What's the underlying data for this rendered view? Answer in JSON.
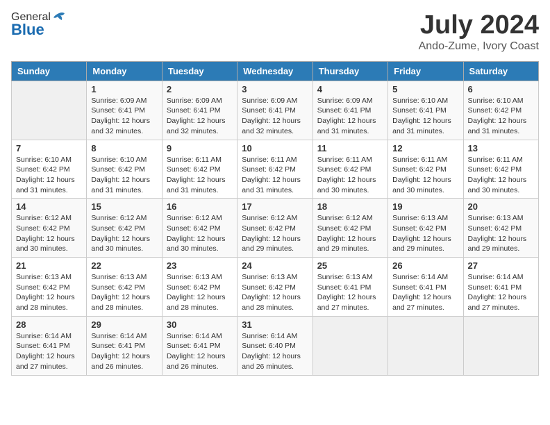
{
  "header": {
    "logo_general": "General",
    "logo_blue": "Blue",
    "month_title": "July 2024",
    "location": "Ando-Zume, Ivory Coast"
  },
  "days_of_week": [
    "Sunday",
    "Monday",
    "Tuesday",
    "Wednesday",
    "Thursday",
    "Friday",
    "Saturday"
  ],
  "weeks": [
    [
      {
        "day": "",
        "info": ""
      },
      {
        "day": "1",
        "info": "Sunrise: 6:09 AM\nSunset: 6:41 PM\nDaylight: 12 hours\nand 32 minutes."
      },
      {
        "day": "2",
        "info": "Sunrise: 6:09 AM\nSunset: 6:41 PM\nDaylight: 12 hours\nand 32 minutes."
      },
      {
        "day": "3",
        "info": "Sunrise: 6:09 AM\nSunset: 6:41 PM\nDaylight: 12 hours\nand 32 minutes."
      },
      {
        "day": "4",
        "info": "Sunrise: 6:09 AM\nSunset: 6:41 PM\nDaylight: 12 hours\nand 31 minutes."
      },
      {
        "day": "5",
        "info": "Sunrise: 6:10 AM\nSunset: 6:41 PM\nDaylight: 12 hours\nand 31 minutes."
      },
      {
        "day": "6",
        "info": "Sunrise: 6:10 AM\nSunset: 6:42 PM\nDaylight: 12 hours\nand 31 minutes."
      }
    ],
    [
      {
        "day": "7",
        "info": "Sunrise: 6:10 AM\nSunset: 6:42 PM\nDaylight: 12 hours\nand 31 minutes."
      },
      {
        "day": "8",
        "info": "Sunrise: 6:10 AM\nSunset: 6:42 PM\nDaylight: 12 hours\nand 31 minutes."
      },
      {
        "day": "9",
        "info": "Sunrise: 6:11 AM\nSunset: 6:42 PM\nDaylight: 12 hours\nand 31 minutes."
      },
      {
        "day": "10",
        "info": "Sunrise: 6:11 AM\nSunset: 6:42 PM\nDaylight: 12 hours\nand 31 minutes."
      },
      {
        "day": "11",
        "info": "Sunrise: 6:11 AM\nSunset: 6:42 PM\nDaylight: 12 hours\nand 30 minutes."
      },
      {
        "day": "12",
        "info": "Sunrise: 6:11 AM\nSunset: 6:42 PM\nDaylight: 12 hours\nand 30 minutes."
      },
      {
        "day": "13",
        "info": "Sunrise: 6:11 AM\nSunset: 6:42 PM\nDaylight: 12 hours\nand 30 minutes."
      }
    ],
    [
      {
        "day": "14",
        "info": "Sunrise: 6:12 AM\nSunset: 6:42 PM\nDaylight: 12 hours\nand 30 minutes."
      },
      {
        "day": "15",
        "info": "Sunrise: 6:12 AM\nSunset: 6:42 PM\nDaylight: 12 hours\nand 30 minutes."
      },
      {
        "day": "16",
        "info": "Sunrise: 6:12 AM\nSunset: 6:42 PM\nDaylight: 12 hours\nand 30 minutes."
      },
      {
        "day": "17",
        "info": "Sunrise: 6:12 AM\nSunset: 6:42 PM\nDaylight: 12 hours\nand 29 minutes."
      },
      {
        "day": "18",
        "info": "Sunrise: 6:12 AM\nSunset: 6:42 PM\nDaylight: 12 hours\nand 29 minutes."
      },
      {
        "day": "19",
        "info": "Sunrise: 6:13 AM\nSunset: 6:42 PM\nDaylight: 12 hours\nand 29 minutes."
      },
      {
        "day": "20",
        "info": "Sunrise: 6:13 AM\nSunset: 6:42 PM\nDaylight: 12 hours\nand 29 minutes."
      }
    ],
    [
      {
        "day": "21",
        "info": "Sunrise: 6:13 AM\nSunset: 6:42 PM\nDaylight: 12 hours\nand 28 minutes."
      },
      {
        "day": "22",
        "info": "Sunrise: 6:13 AM\nSunset: 6:42 PM\nDaylight: 12 hours\nand 28 minutes."
      },
      {
        "day": "23",
        "info": "Sunrise: 6:13 AM\nSunset: 6:42 PM\nDaylight: 12 hours\nand 28 minutes."
      },
      {
        "day": "24",
        "info": "Sunrise: 6:13 AM\nSunset: 6:42 PM\nDaylight: 12 hours\nand 28 minutes."
      },
      {
        "day": "25",
        "info": "Sunrise: 6:13 AM\nSunset: 6:41 PM\nDaylight: 12 hours\nand 27 minutes."
      },
      {
        "day": "26",
        "info": "Sunrise: 6:14 AM\nSunset: 6:41 PM\nDaylight: 12 hours\nand 27 minutes."
      },
      {
        "day": "27",
        "info": "Sunrise: 6:14 AM\nSunset: 6:41 PM\nDaylight: 12 hours\nand 27 minutes."
      }
    ],
    [
      {
        "day": "28",
        "info": "Sunrise: 6:14 AM\nSunset: 6:41 PM\nDaylight: 12 hours\nand 27 minutes."
      },
      {
        "day": "29",
        "info": "Sunrise: 6:14 AM\nSunset: 6:41 PM\nDaylight: 12 hours\nand 26 minutes."
      },
      {
        "day": "30",
        "info": "Sunrise: 6:14 AM\nSunset: 6:41 PM\nDaylight: 12 hours\nand 26 minutes."
      },
      {
        "day": "31",
        "info": "Sunrise: 6:14 AM\nSunset: 6:40 PM\nDaylight: 12 hours\nand 26 minutes."
      },
      {
        "day": "",
        "info": ""
      },
      {
        "day": "",
        "info": ""
      },
      {
        "day": "",
        "info": ""
      }
    ]
  ]
}
